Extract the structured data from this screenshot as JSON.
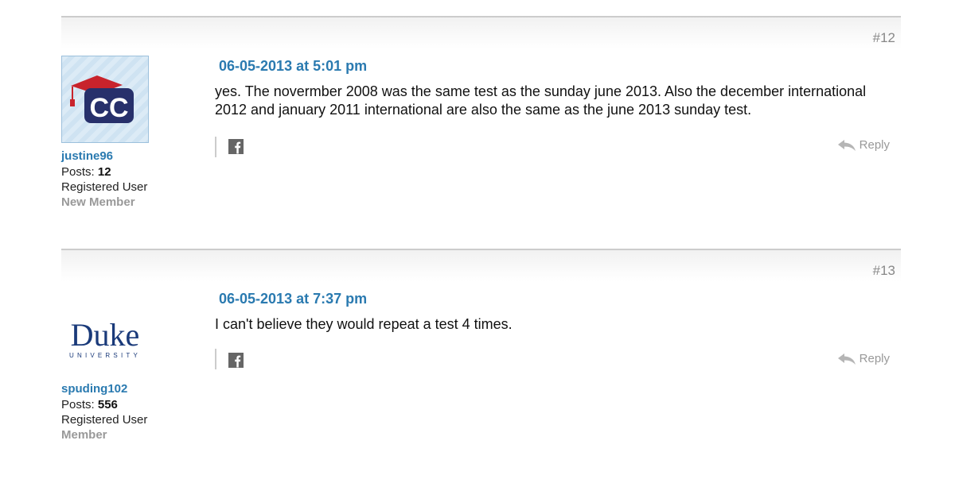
{
  "posts": [
    {
      "number": "#12",
      "date": "06-05-2013 at 5:01 pm",
      "body": "yes. The novermber 2008 was the same test as the sunday june 2013. Also the december international 2012 and january 2011 international are also the same as the june 2013 sunday test.",
      "user": {
        "name": "justine96",
        "posts_label": "Posts:",
        "posts_count": "12",
        "role": "Registered User",
        "rank": "New Member",
        "avatar_text": "CC"
      },
      "reply_label": "Reply"
    },
    {
      "number": "#13",
      "date": "06-05-2013 at 7:37 pm",
      "body": "I can't believe they would repeat a test 4 times.",
      "user": {
        "name": "spuding102",
        "posts_label": "Posts:",
        "posts_count": "556",
        "role": "Registered User",
        "rank": "Member",
        "avatar_text": "Duke",
        "avatar_subtext": "UNIVERSITY"
      },
      "reply_label": "Reply"
    }
  ],
  "colors": {
    "link": "#2a7ab0",
    "muted": "#999999",
    "text": "#111111",
    "cc_navy": "#27306b",
    "cc_red": "#c8232c",
    "duke_navy": "#1a3a7a"
  },
  "icons": {
    "share": "facebook-icon",
    "reply": "reply-arrow-icon"
  }
}
